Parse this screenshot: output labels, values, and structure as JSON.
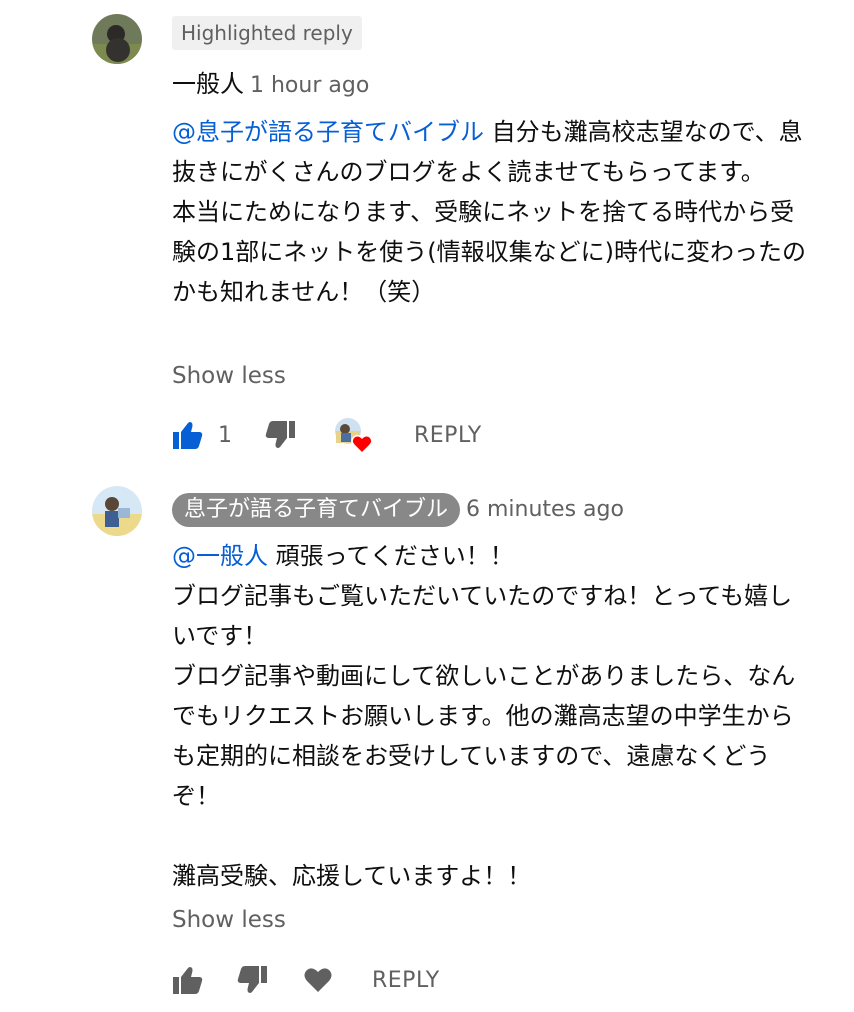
{
  "comments": [
    {
      "badge": "Highlighted reply",
      "author": "一般人",
      "time": "1 hour ago",
      "mention": "@息子が語る子育てバイブル",
      "body": " 自分も灘高校志望なので、息抜きにがくさんのブログをよく読ませてもらってます。\n本当にためになります、受験にネットを捨てる時代から受験の1部にネットを使う(情報収集などに)時代に変わったのかも知れません！（笑）",
      "show_less": "Show less",
      "like_count": "1",
      "reply_label": "REPLY",
      "icons": [
        "thumb-up-filled-icon",
        "thumb-down-icon",
        "creator-heart-icon"
      ]
    },
    {
      "author": "息子が語る子育てバイブル",
      "time": "6 minutes ago",
      "mention": "@一般人",
      "body": " 頑張ってください！！\nブログ記事もご覧いただいていたのですね！とっても嬉しいです！\nブログ記事や動画にして欲しいことがありましたら、なんでもリクエストお願いします。他の灘高志望の中学生からも定期的に相談をお受けしていますので、遠慮なくどうぞ！\n\n灘高受験、応援していますよ！！",
      "show_less": "Show less",
      "reply_label": "REPLY",
      "icons": [
        "thumb-up-icon",
        "thumb-down-icon",
        "heart-icon"
      ]
    }
  ],
  "colors": {
    "mention": "#065fd4",
    "secondary_text": "#606060",
    "like_active": "#065fd4",
    "heart": "#ff0000"
  }
}
